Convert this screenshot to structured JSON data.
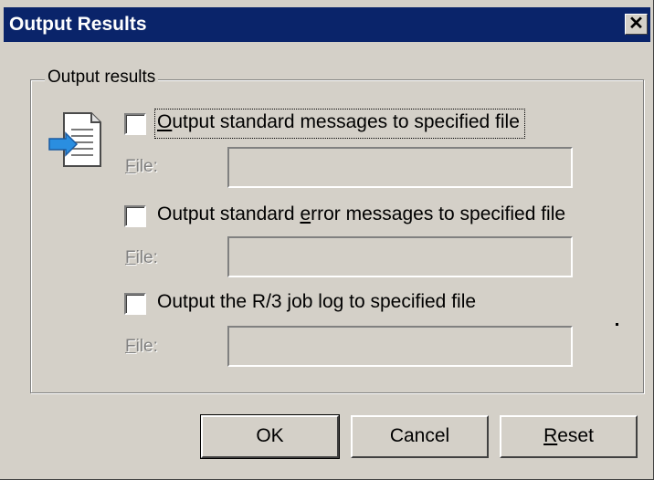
{
  "window": {
    "title": "Output Results",
    "close_glyph": "✕"
  },
  "group": {
    "legend": "Output results"
  },
  "options": [
    {
      "label_pre": "",
      "label_accel": "O",
      "label_post": "utput standard messages to specified file",
      "checked": false,
      "file_label_accel": "F",
      "file_label_post": "ile:",
      "file_value": ""
    },
    {
      "label_pre": "Output standard ",
      "label_accel": "e",
      "label_post": "rror messages to specified file",
      "checked": false,
      "file_label_accel": "F",
      "file_label_post": "ile:",
      "file_value": ""
    },
    {
      "label_pre": "Output the R/3 job log to specified file",
      "label_accel": "",
      "label_post": "",
      "checked": false,
      "file_label_accel": "F",
      "file_label_post": "ile:",
      "file_value": ""
    }
  ],
  "buttons": {
    "ok": "OK",
    "cancel": "Cancel",
    "reset_accel": "R",
    "reset_post": "eset"
  },
  "icons": {
    "document_arrow": "document-arrow-icon",
    "close": "close-icon"
  }
}
